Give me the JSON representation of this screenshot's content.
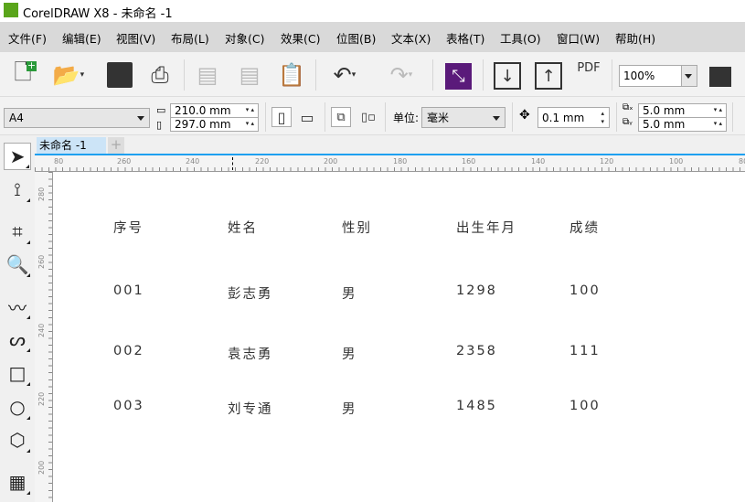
{
  "window": {
    "title": "CorelDRAW X8 - 未命名 -1"
  },
  "menu": [
    "文件(F)",
    "编辑(E)",
    "视图(V)",
    "布局(L)",
    "对象(C)",
    "效果(C)",
    "位图(B)",
    "文本(X)",
    "表格(T)",
    "工具(O)",
    "窗口(W)",
    "帮助(H)"
  ],
  "toolbar": {
    "zoom": "100%",
    "pdf_label": "PDF"
  },
  "propbar": {
    "page_size": "A4",
    "width": "210.0 mm",
    "height": "297.0 mm",
    "unit_label": "单位:",
    "unit": "毫米",
    "nudge": "0.1 mm",
    "dup_x": "5.0 mm",
    "dup_y": "5.0 mm"
  },
  "tabs": {
    "doc": "未命名 -1",
    "add": "+"
  },
  "ruler": {
    "h": [
      "80",
      "260",
      "240",
      "220",
      "200",
      "180",
      "160",
      "140",
      "120",
      "100",
      "80"
    ],
    "v": [
      "280",
      "260",
      "240",
      "220",
      "200"
    ]
  },
  "table": {
    "headers": [
      "序号",
      "姓名",
      "性别",
      "出生年月",
      "成绩"
    ],
    "rows": [
      [
        "001",
        "彭志勇",
        "男",
        "1298",
        "100"
      ],
      [
        "002",
        "袁志勇",
        "男",
        "2358",
        "111"
      ],
      [
        "003",
        "刘专通",
        "男",
        "1485",
        "100"
      ]
    ]
  }
}
